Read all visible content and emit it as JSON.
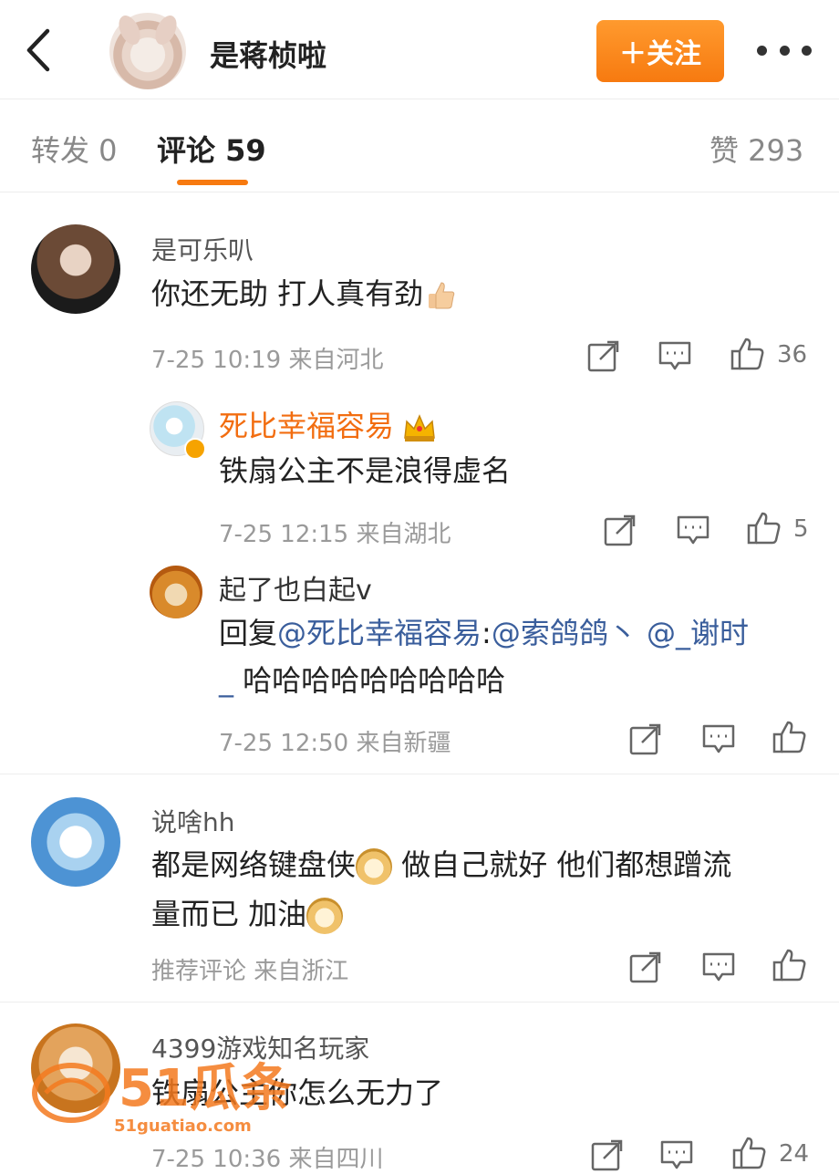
{
  "header": {
    "back_icon": "back-chevron-icon",
    "name": "是蒋桢啦",
    "follow_label": "＋关注",
    "more_icon": "more-dots-icon"
  },
  "tabs": {
    "repost": "转发 0",
    "comment": "评论 59",
    "like": "赞 293"
  },
  "comments": [
    {
      "name": "是可乐叭",
      "text": "你还无助 打人真有劲",
      "time": "7-25 10:19",
      "location": "来自河北",
      "likes": "36",
      "replies": [
        {
          "name": "死比幸福容易",
          "text": "铁扇公主不是浪得虚名",
          "time": "7-25 12:15",
          "location": "来自湖北",
          "likes": "5"
        },
        {
          "name": "起了也白起v",
          "reply_prefix": "回复",
          "mention1": "@死比幸福容易",
          "colon": ":",
          "mention2": "@索鸽鸽丶 @_谢时",
          "mention3": "_",
          "text_line2": " 哈哈哈哈哈哈哈哈哈",
          "time": "7-25 12:50",
          "location": "来自新疆",
          "likes": ""
        }
      ]
    },
    {
      "name": "说啥hh",
      "text_line1a": "都是网络键盘侠",
      "text_line1b": " 做自己就好 他们都想蹭流",
      "text_line2": "量而已 加油",
      "time": "推荐评论",
      "location": "来自浙江",
      "likes": ""
    },
    {
      "name": "4399游戏知名玩家",
      "text": "铁扇公主你怎么无力了",
      "time": "7-25 10:36",
      "location": "来自四川",
      "likes": "24"
    }
  ],
  "watermark": {
    "brand": "51瓜条",
    "domain": "51guatiao.com"
  },
  "colors": {
    "accent": "#f77a10",
    "mention": "#3a5e9c",
    "highlight_name": "#f26d10"
  }
}
